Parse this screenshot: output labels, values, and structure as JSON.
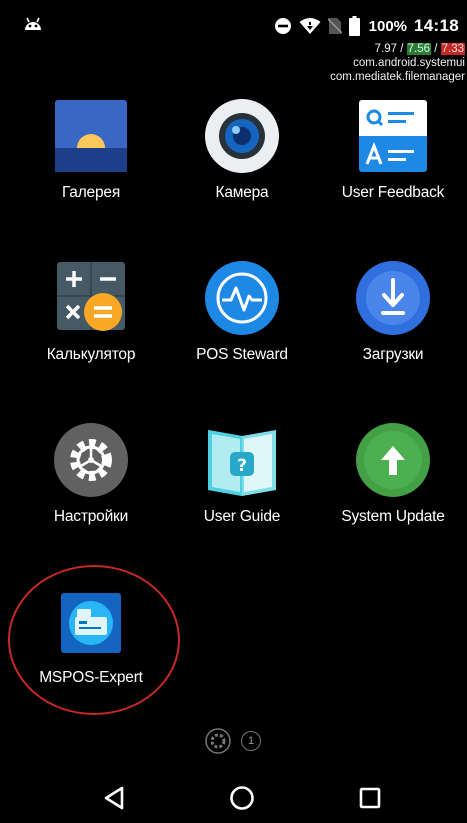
{
  "status_bar": {
    "battery_percent": "100%",
    "time": "14:18",
    "icons": [
      "android-notification-icon",
      "do-not-disturb-icon",
      "wifi-icon",
      "no-sim-icon",
      "battery-icon"
    ]
  },
  "debug_overlay": {
    "load_a": "7.97",
    "load_b": "7.56",
    "load_c": "7.33",
    "separator": " / ",
    "process_1": "com.android.systemui",
    "process_2": "com.mediatek.filemanager"
  },
  "apps": [
    {
      "label": "Галерея",
      "icon": "gallery-icon"
    },
    {
      "label": "Камера",
      "icon": "camera-icon"
    },
    {
      "label": "User Feedback",
      "icon": "user-feedback-icon"
    },
    {
      "label": "Калькулятор",
      "icon": "calculator-icon"
    },
    {
      "label": "POS Steward",
      "icon": "pos-steward-icon"
    },
    {
      "label": "Загрузки",
      "icon": "downloads-icon"
    },
    {
      "label": "Настройки",
      "icon": "settings-icon"
    },
    {
      "label": "User Guide",
      "icon": "user-guide-icon"
    },
    {
      "label": "System Update",
      "icon": "system-update-icon"
    },
    {
      "label": "MSPOS-Expert",
      "icon": "mspos-expert-icon"
    }
  ],
  "page_indicator": {
    "current_page": "1"
  },
  "nav_bar": {
    "buttons": [
      "back-icon",
      "home-icon",
      "recents-icon"
    ]
  },
  "colors": {
    "background": "#000000",
    "annotation_circle": "#c62828"
  }
}
